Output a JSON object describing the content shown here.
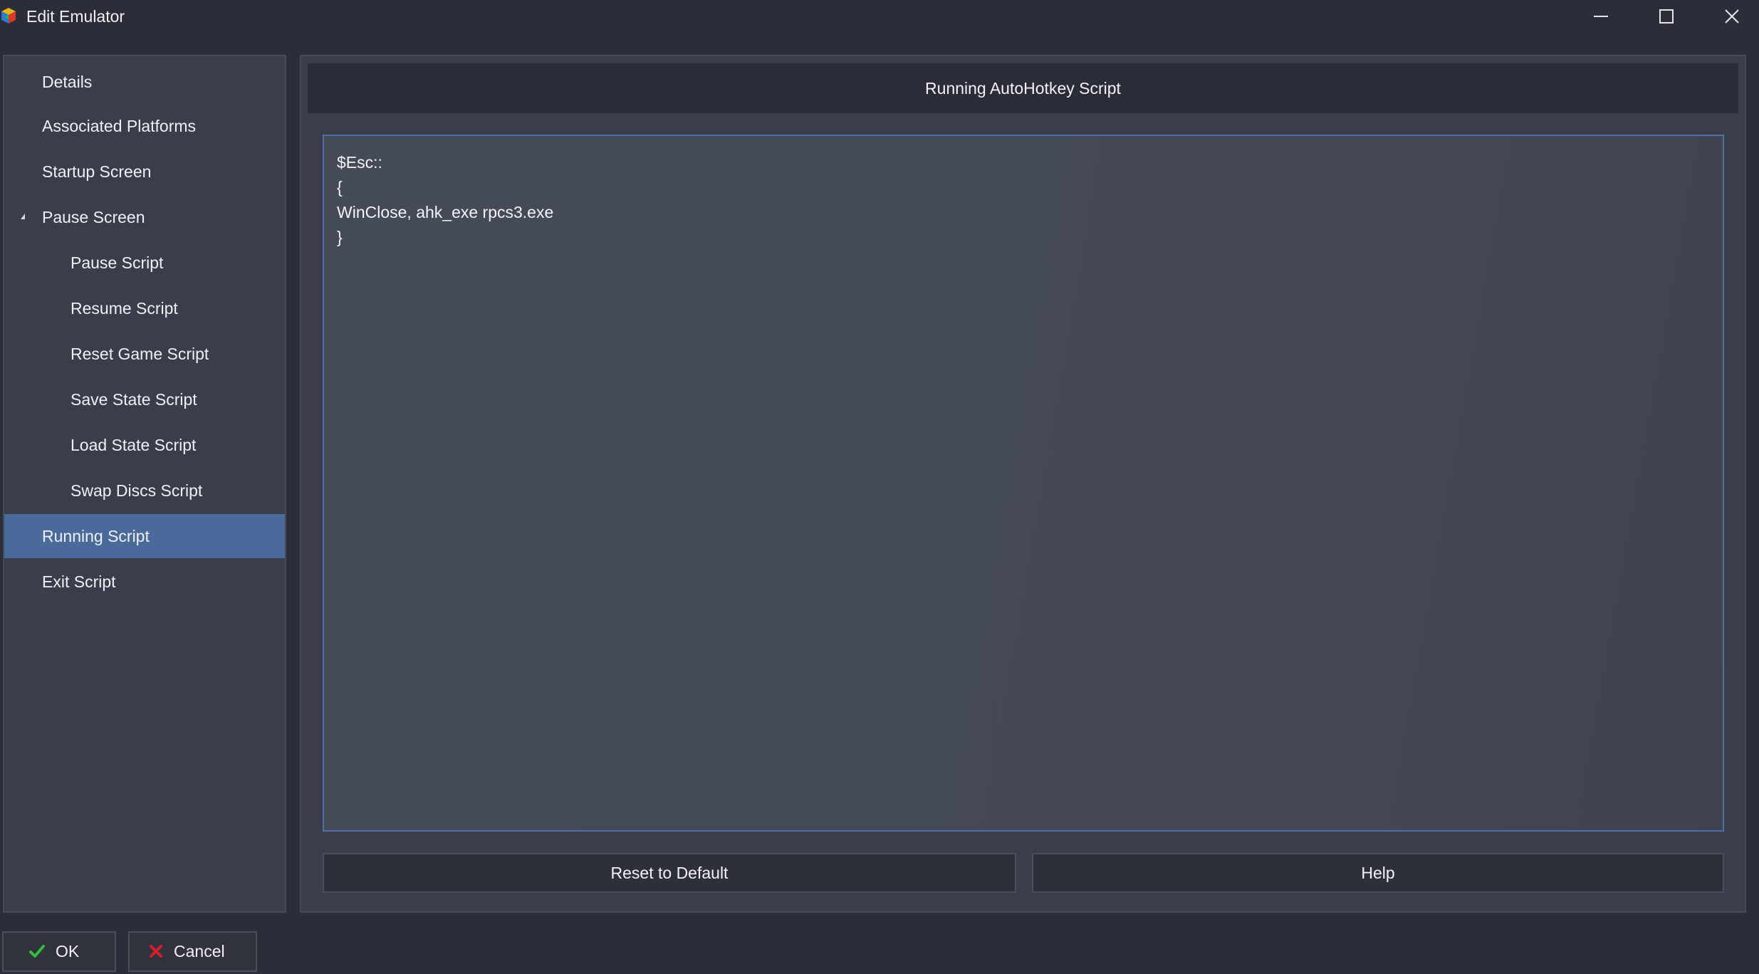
{
  "window": {
    "title": "Edit Emulator",
    "icon": "app-logo-icon",
    "controls": [
      "minimize-icon",
      "maximize-icon",
      "close-icon"
    ]
  },
  "sidebar": {
    "items": [
      {
        "label": "Details",
        "level": 1
      },
      {
        "label": "Associated Platforms",
        "level": 1
      },
      {
        "label": "Startup Screen",
        "level": 1
      },
      {
        "label": "Pause Screen",
        "level": 1,
        "expanded": true
      },
      {
        "label": "Pause Script",
        "level": 2
      },
      {
        "label": "Resume Script",
        "level": 2
      },
      {
        "label": "Reset Game Script",
        "level": 2
      },
      {
        "label": "Save State Script",
        "level": 2
      },
      {
        "label": "Load State Script",
        "level": 2
      },
      {
        "label": "Swap Discs Script",
        "level": 2
      },
      {
        "label": "Running Script",
        "level": 1,
        "selected": true
      },
      {
        "label": "Exit Script",
        "level": 1
      }
    ]
  },
  "main": {
    "header": "Running AutoHotkey Script",
    "script": "$Esc::\n{\nWinClose, ahk_exe rpcs3.exe\n}",
    "reset_label": "Reset to Default",
    "help_label": "Help"
  },
  "footer": {
    "ok_label": "OK",
    "cancel_label": "Cancel"
  },
  "colors": {
    "background": "#2b2e38",
    "panel": "#3a3e4b",
    "selected": "#4a6a9c",
    "editor_border": "#4f6fa7",
    "ok_check": "#2fbf3a",
    "cancel_x": "#d4202a"
  }
}
